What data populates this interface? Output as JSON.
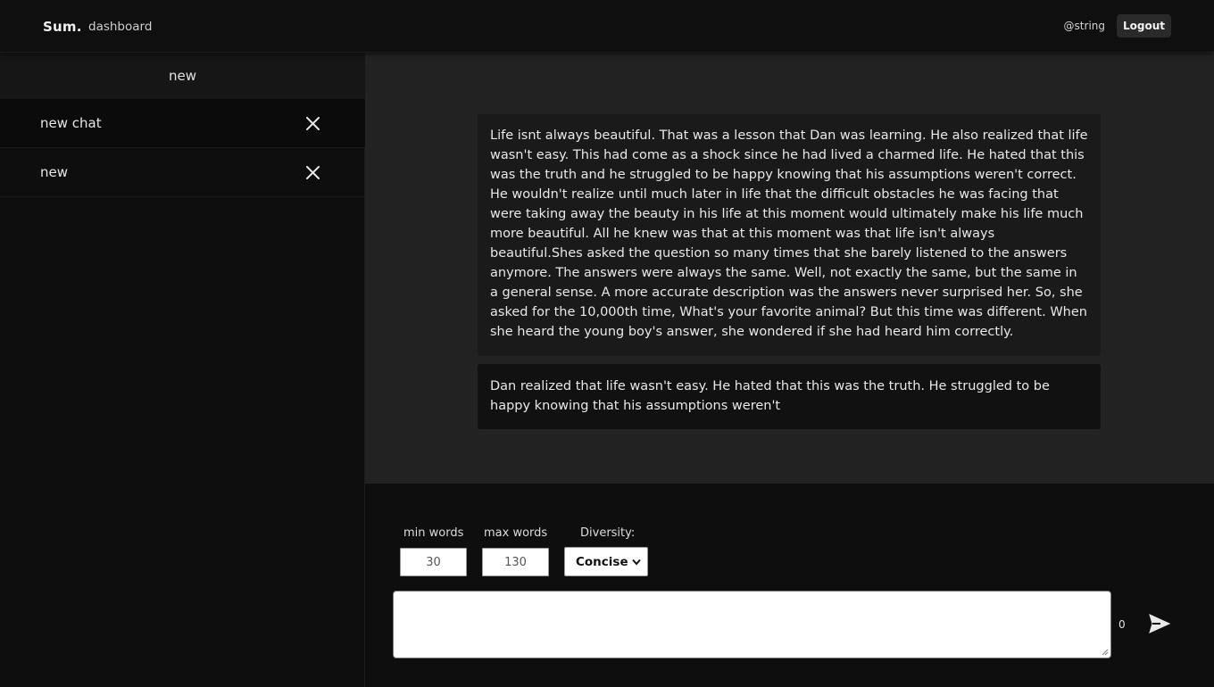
{
  "header": {
    "brand": "Sum.",
    "nav_dashboard": "dashboard",
    "username": "@string",
    "logout_label": "Logout"
  },
  "sidebar": {
    "new_label": "new",
    "items": [
      {
        "label": "new chat",
        "icon": "close-icon"
      },
      {
        "label": "new",
        "icon": "close-icon"
      }
    ]
  },
  "chat": {
    "messages": [
      {
        "role": "user",
        "text": "Life isnt always beautiful. That was a lesson that Dan was learning. He also realized that life wasn't easy. This had come as a shock since he had lived a charmed life. He hated that this was the truth and he struggled to be happy knowing that his assumptions weren't correct. He wouldn't realize until much later in life that the difficult obstacles he was facing that were taking away the beauty in his life at this moment would ultimately make his life much more beautiful. All he knew was that at this moment was that life isn't always beautiful.Shes asked the question so many times that she barely listened to the answers anymore. The answers were always the same. Well, not exactly the same, but the same in a general sense. A more accurate description was the answers never surprised her. So, she asked for the 10,000th time, What's your favorite animal? But this time was different. When she heard the young boy's answer, she wondered if she had heard him correctly."
      },
      {
        "role": "assistant",
        "text": "Dan realized that life wasn't easy. He hated that this was the truth. He struggled to be happy knowing that his assumptions weren't"
      }
    ]
  },
  "composer": {
    "min_words_label": "min words",
    "min_words_value": "30",
    "max_words_label": "max words",
    "max_words_value": "130",
    "diversity_label": "Diversity:",
    "diversity_selected": "Concise",
    "textarea_value": "",
    "char_count": "0",
    "send_icon": "send-icon"
  },
  "colors": {
    "background": "#0e0e0e",
    "chat_area": "#222222",
    "user_bubble": "#1a1a1a",
    "bot_bubble": "#111111"
  }
}
